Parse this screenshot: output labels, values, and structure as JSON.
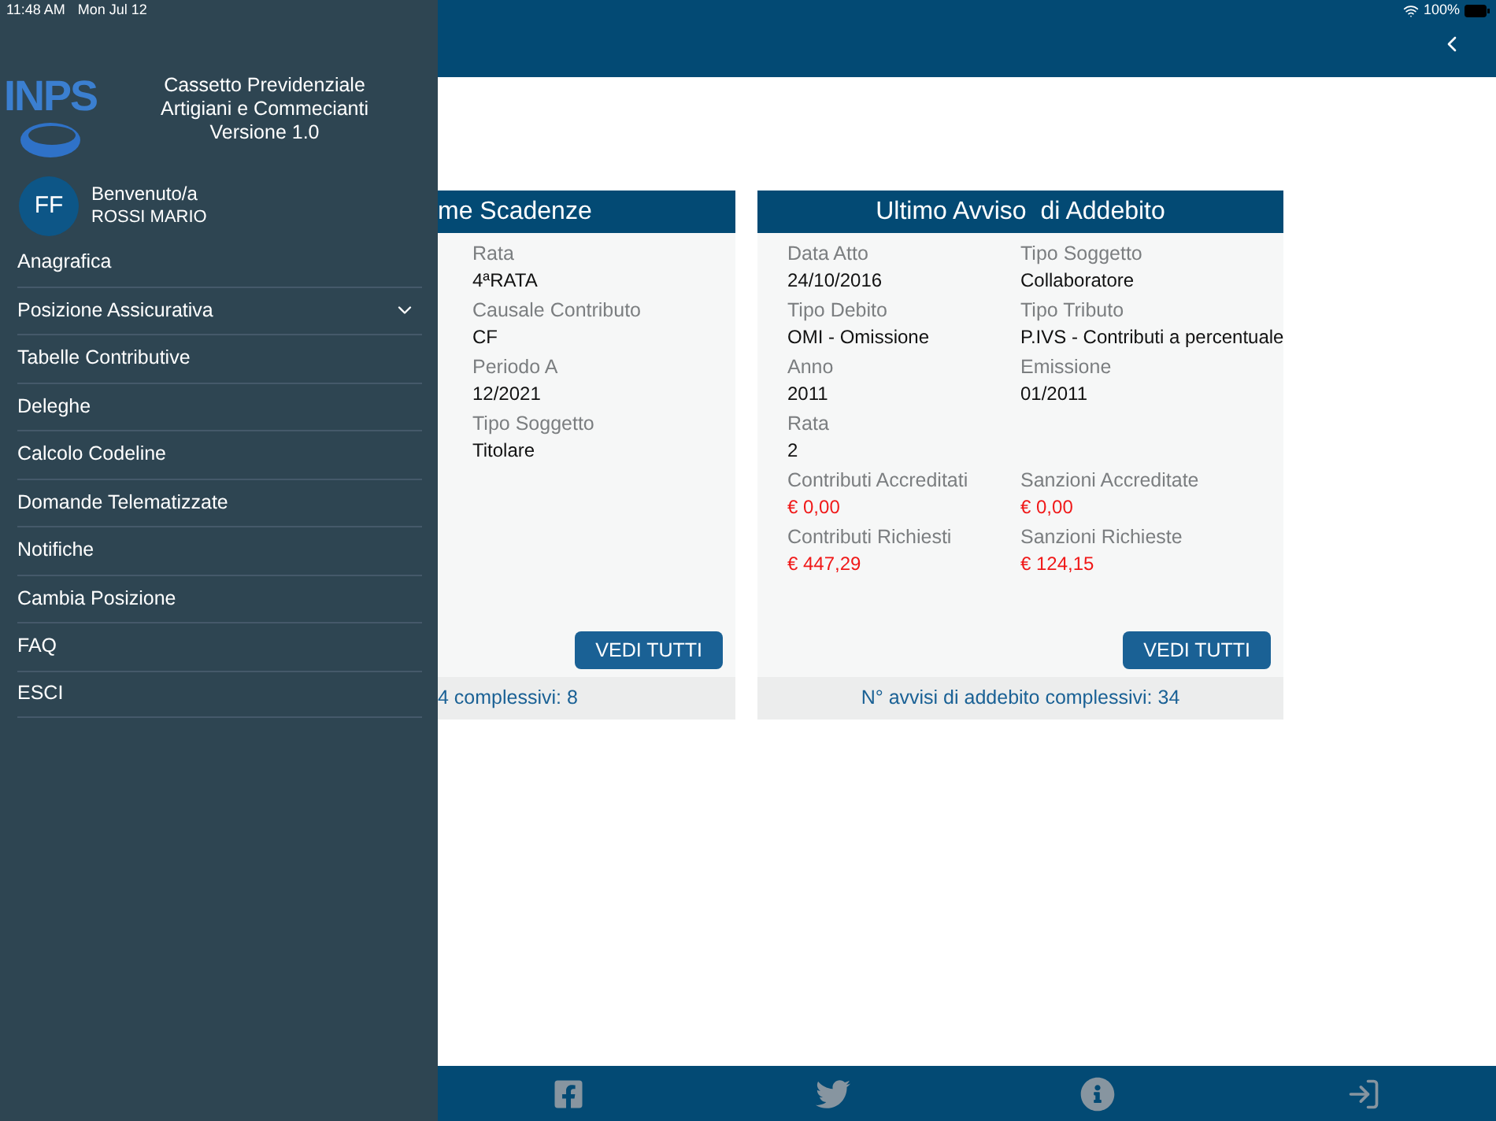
{
  "status_bar": {
    "time": "11:48 AM",
    "date": "Mon Jul 12",
    "battery": "100%"
  },
  "drawer": {
    "logo_text": "INPS",
    "app_title": [
      "Cassetto Previdenziale",
      "Artigiani e Commecianti",
      "Versione 1.0"
    ],
    "user": {
      "initials": "FF",
      "greeting": "Benvenuto/a",
      "name": "ROSSI MARIO"
    },
    "menu": [
      {
        "label": "Anagrafica",
        "kind": "link"
      },
      {
        "label": "Posizione Assicurativa",
        "kind": "group"
      },
      {
        "label": "Tabelle Contributive",
        "kind": "link"
      },
      {
        "label": "Deleghe",
        "kind": "link"
      },
      {
        "label": "Calcolo Codeline",
        "kind": "link"
      },
      {
        "label": "Domande Telematizzate",
        "kind": "link"
      },
      {
        "label": "Notifiche",
        "kind": "link"
      },
      {
        "label": "Cambia Posizione",
        "kind": "link"
      },
      {
        "label": "FAQ",
        "kind": "link"
      },
      {
        "label": "ESCI",
        "kind": "link"
      }
    ]
  },
  "cards": [
    {
      "title": "me Scadenze",
      "rows": [
        [
          {
            "label": "Rata",
            "value": "4ªRATA",
            "kind": "text"
          }
        ],
        [
          {
            "label": "Causale Contributo",
            "value": "CF",
            "kind": "text"
          }
        ],
        [
          {
            "label": "Periodo A",
            "value": "12/2021",
            "kind": "text"
          }
        ],
        [
          {
            "label": "Tipo Soggetto",
            "value": "Titolare",
            "kind": "text"
          }
        ]
      ],
      "button": "VEDI TUTTI",
      "footer": "4 complessivi: 8"
    },
    {
      "title": "Ultimo Avviso  di Addebito",
      "rows": [
        [
          {
            "label": "Data Atto",
            "value": "24/10/2016",
            "kind": "text"
          },
          {
            "label": "Tipo Soggetto",
            "value": "Collaboratore",
            "kind": "text"
          }
        ],
        [
          {
            "label": "Tipo Debito",
            "value": "OMI - Omissione",
            "kind": "text"
          },
          {
            "label": "Tipo Tributo",
            "value": "P.IVS - Contributi a percentuale",
            "kind": "text"
          }
        ],
        [
          {
            "label": "Anno",
            "value": "2011",
            "kind": "text"
          },
          {
            "label": "Emissione",
            "value": "01/2011",
            "kind": "text"
          }
        ],
        [
          {
            "label": "Rata",
            "value": "2",
            "kind": "text"
          }
        ],
        [
          {
            "label": "Contributi Accreditati",
            "value": "€ 0,00",
            "kind": "amount"
          },
          {
            "label": "Sanzioni Accreditate",
            "value": "€ 0,00",
            "kind": "amount"
          }
        ],
        [
          {
            "label": "Contributi Richiesti",
            "value": "€ 447,29",
            "kind": "amount"
          },
          {
            "label": "Sanzioni Richieste",
            "value": "€ 124,15",
            "kind": "amount"
          }
        ]
      ],
      "button": "VEDI TUTTI",
      "footer": "N° avvisi di addebito complessivi: 34"
    }
  ],
  "tab_bar": [
    {
      "kind": "facebook"
    },
    {
      "kind": "twitter"
    },
    {
      "kind": "info"
    },
    {
      "kind": "login"
    }
  ]
}
